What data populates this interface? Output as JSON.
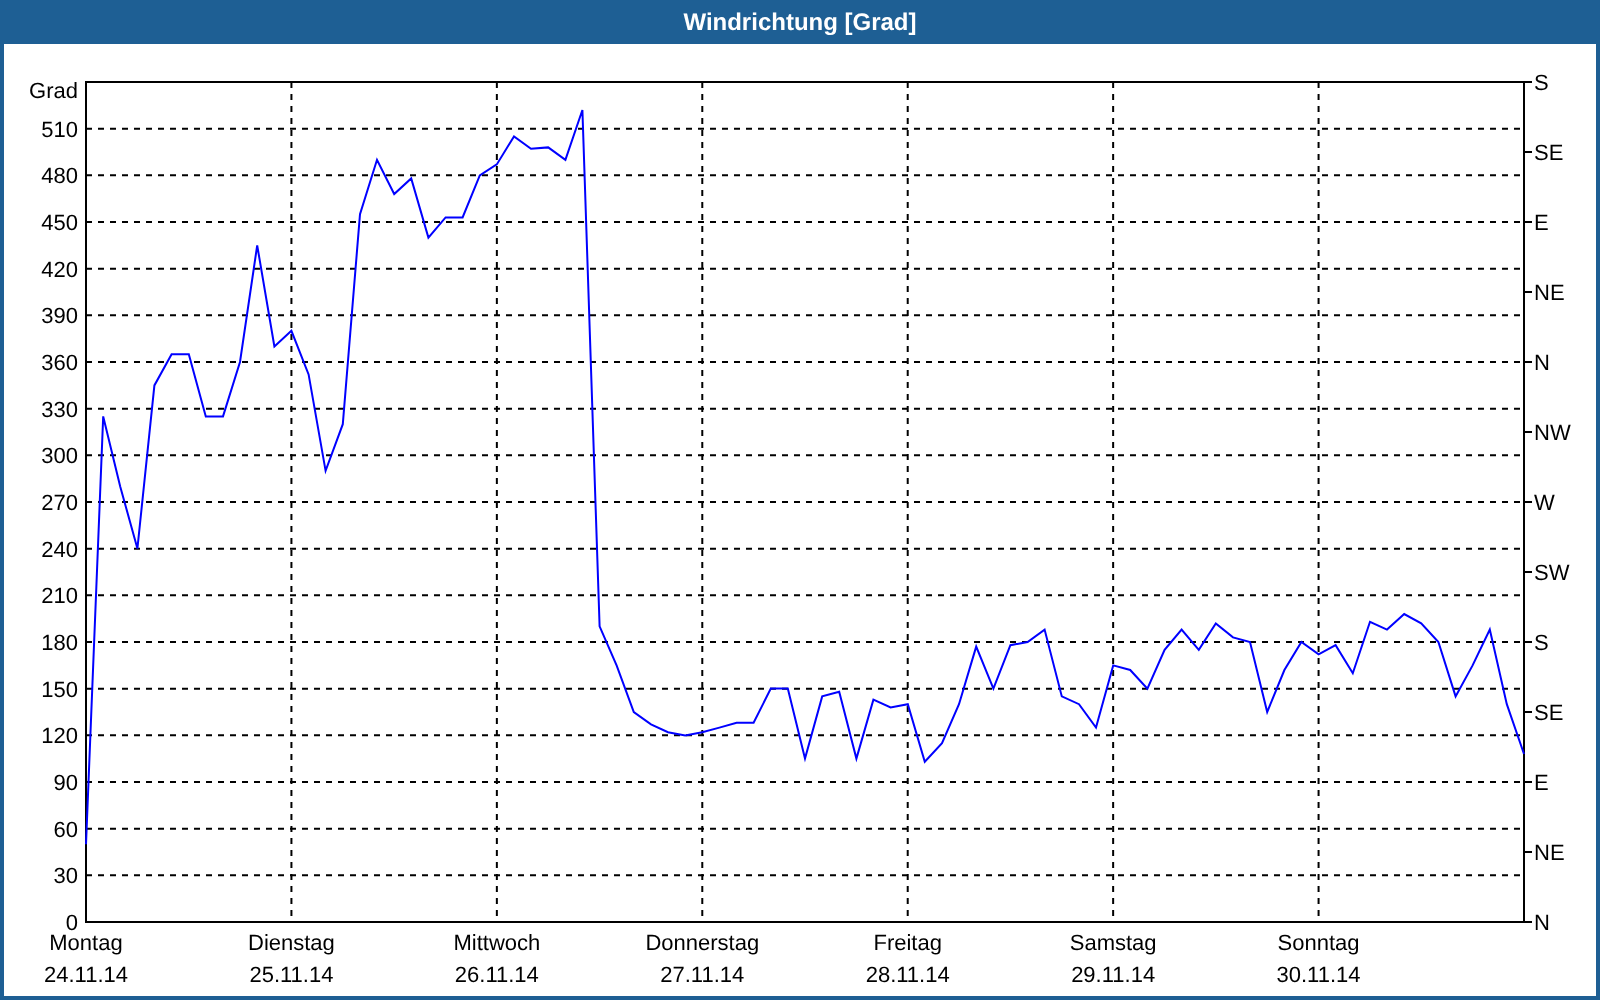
{
  "window": {
    "title": "Windrichtung [Grad]"
  },
  "chart": {
    "x_tick_dates": [
      "24.11.14",
      "25.11.14",
      "26.11.14",
      "27.11.14",
      "28.11.14",
      "29.11.14",
      "30.11.14"
    ],
    "right_axis": {
      "ticks": [
        "S",
        "SE",
        "E",
        "NE",
        "N",
        "NW",
        "W",
        "SW",
        "S",
        "SE",
        "E",
        "NE",
        "N"
      ]
    },
    "chart_data": {
      "type": "line",
      "ylabel": "Grad",
      "grid": true,
      "ylim": [
        0,
        540
      ],
      "yticks": [
        0,
        30,
        60,
        90,
        120,
        150,
        180,
        210,
        240,
        270,
        300,
        330,
        360,
        390,
        420,
        450,
        480,
        510
      ],
      "categories": [
        "Montag",
        null,
        null,
        null,
        null,
        null,
        null,
        null,
        null,
        null,
        null,
        null,
        "Dienstag",
        null,
        null,
        null,
        null,
        null,
        null,
        null,
        null,
        null,
        null,
        null,
        "Mittwoch",
        null,
        null,
        null,
        null,
        null,
        null,
        null,
        null,
        null,
        null,
        null,
        "Donnerstag",
        null,
        null,
        null,
        null,
        null,
        null,
        null,
        null,
        null,
        null,
        null,
        "Freitag",
        null,
        null,
        null,
        null,
        null,
        null,
        null,
        null,
        null,
        null,
        null,
        "Samstag",
        null,
        null,
        null,
        null,
        null,
        null,
        null,
        null,
        null,
        null,
        null,
        "Sonntag",
        null,
        null,
        null,
        null,
        null,
        null,
        null,
        null,
        null,
        null,
        null,
        null
      ],
      "series": [
        {
          "color": "#0000ff",
          "values": [
            50,
            325,
            280,
            240,
            345,
            365,
            365,
            325,
            325,
            360,
            435,
            370,
            380,
            352,
            290,
            320,
            455,
            490,
            468,
            478,
            440,
            453,
            453,
            480,
            487,
            505,
            497,
            498,
            490,
            522,
            190,
            165,
            135,
            127,
            122,
            120,
            122,
            125,
            128,
            128,
            150,
            150,
            105,
            145,
            148,
            105,
            143,
            138,
            140,
            103,
            115,
            140,
            177,
            150,
            178,
            180,
            188,
            145,
            140,
            125,
            165,
            162,
            150,
            175,
            188,
            175,
            192,
            183,
            180,
            135,
            162,
            180,
            172,
            178,
            160,
            193,
            188,
            198,
            192,
            180,
            145,
            165,
            188,
            140,
            108
          ]
        }
      ]
    }
  }
}
